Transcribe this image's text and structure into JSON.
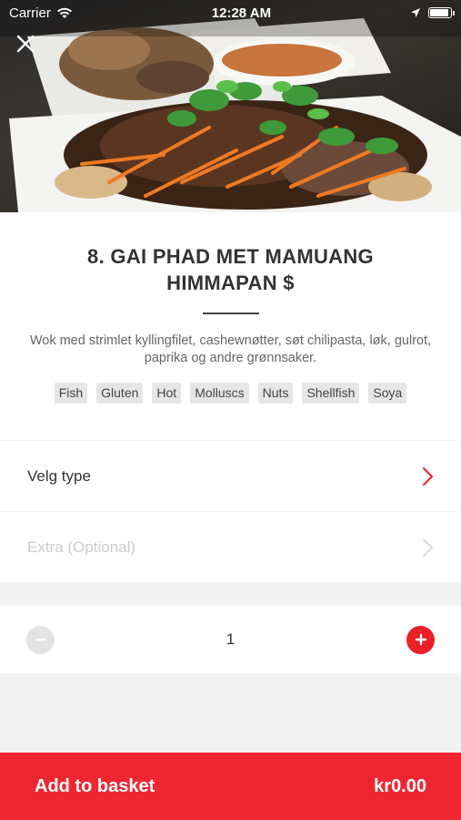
{
  "status_bar": {
    "carrier": "Carrier",
    "time": "12:28 AM",
    "battery_level": 0.9
  },
  "icons": {
    "close": "close-icon",
    "wifi": "wifi-icon",
    "location": "location-arrow-icon",
    "battery": "battery-icon",
    "chevron": "chevron-right-icon",
    "minus": "minus-icon",
    "plus": "plus-icon"
  },
  "dish": {
    "title": "8. GAI PHAD MET MAMUANG HIMMAPAN $",
    "description": "Wok med strimlet kyllingfilet, cashewnøtter, søt chilipasta, løk, gulrot, paprika og andre grønnsaker.",
    "allergens": [
      "Fish",
      "Gluten",
      "Hot",
      "Molluscs",
      "Nuts",
      "Shellfish",
      "Soya"
    ]
  },
  "options": {
    "type_label": "Velg type",
    "extra_label": "Extra (Optional)"
  },
  "quantity": {
    "value": "1"
  },
  "basket": {
    "label": "Add to basket",
    "price": "kr0.00"
  },
  "colors": {
    "accent": "#ef2631",
    "disabled": "#cccccc"
  }
}
